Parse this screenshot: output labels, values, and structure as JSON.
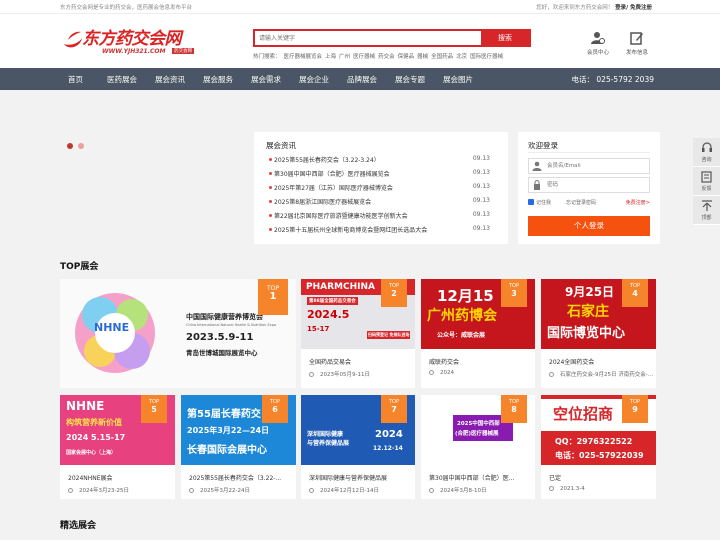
{
  "topbar": {
    "slogan": "东方药交会网是专业的药交会，医药展会信息发布平台",
    "welcome": "您好，欢迎来到东方药交会网！",
    "auth": "登录/ 免费注册"
  },
  "header": {
    "logo_name": "东方药交会网",
    "logo_url": "WWW.YJH321.COM",
    "logo_tag": "药交会网",
    "search_placeholder": "请输入关键字",
    "search_button": "搜索",
    "hot_label": "热门搜索：",
    "hot_words": [
      "医疗器械展览会",
      "上海",
      "广州",
      "医疗器械",
      "药交会",
      "保健品",
      "器械",
      "全国药品",
      "北京",
      "国际医疗器械"
    ],
    "member_center": "会员中心",
    "publish_info": "发布信息"
  },
  "nav": {
    "items": [
      "首页",
      "医药展会",
      "展会资讯",
      "展会服务",
      "展会需求",
      "展会企业",
      "品牌展会",
      "展会专题",
      "展会图片"
    ],
    "phone": "电话： 025-5792 2039"
  },
  "news": {
    "title": "展会资讯",
    "items": [
      {
        "title": "2025第55届长春药交会（3.22-3.24）",
        "date": "09.13"
      },
      {
        "title": "第30届中国中西部（合肥）医疗器械展览会",
        "date": "09.13"
      },
      {
        "title": "2025年第27届（江苏）国际医疗器械博览会",
        "date": "09.13"
      },
      {
        "title": "2025第8届浙江国际医疗器械展览会",
        "date": "09.13"
      },
      {
        "title": "第22届北京国际医疗旅游暨健康功能医学创新大会",
        "date": "09.13"
      },
      {
        "title": "2025第十五届杭州全球新电商博览会暨网红团长选品大会",
        "date": "09.13"
      }
    ]
  },
  "login": {
    "title": "欢迎登录",
    "user_placeholder": "会员名/Emali",
    "pass_placeholder": "密码",
    "remember": "记住我",
    "forgot": "忘记登录密码",
    "register": "免费注册>",
    "submit": "个人登录"
  },
  "side": {
    "consult": "咨询",
    "feedback": "反馈",
    "top": "顶部"
  },
  "sections": {
    "top": "TOP展会",
    "featured": "精选展会"
  },
  "badge_label": "TOP",
  "cards": [
    {
      "rank": "1",
      "caption": "",
      "sub": "",
      "img": {
        "t1": "NHNE",
        "t2": "中国国际健康营养博览会",
        "t3": "China International Natural Health & Nutrition Expo",
        "t4": "2023.5.9-11",
        "t5": "青岛世博城国际展览中心"
      }
    },
    {
      "rank": "2",
      "caption": "全国药品交易会",
      "sub": "2023年05月9-11日",
      "img": {
        "t1": "PHARMCHINA",
        "t2": "第88届全国药品交易会",
        "t3": "2024.5",
        "t4": "15-17",
        "t5": "扫码预登记 免排队进场"
      }
    },
    {
      "rank": "3",
      "caption": "威联药交会",
      "sub": "2024",
      "img": {
        "t1": "12月15",
        "t2": "广州药博会",
        "t3": "公众号：威联会展"
      }
    },
    {
      "rank": "4",
      "caption": "2024全国药交会",
      "sub": "石家庄药交会-9月25日 济南药交会-...",
      "img": {
        "t1": "9月25日",
        "t2": "石家庄",
        "t3": "国际博览中心"
      }
    },
    {
      "rank": "5",
      "caption": "2024NHNE展会",
      "sub": "2024年3月23-25日",
      "img": {
        "t1": "NHNE",
        "t2": "构筑营养新价值",
        "t3": "2024 5.15-17",
        "t4": "国家会展中心（上海）"
      }
    },
    {
      "rank": "6",
      "caption": "2025第55届长春药交会（3.22-...",
      "sub": "2025年3月22-24日",
      "img": {
        "t1": "第55届长春药交",
        "t2": "2025年3月22—24日",
        "t3": "长春国际会展中心"
      }
    },
    {
      "rank": "7",
      "caption": "深圳国际健康与营养保健品展",
      "sub": "2024年12月12日-14日",
      "img": {
        "t1": "深圳国际健康",
        "t2": "与营养保健品展",
        "t3": "2024",
        "t4": "12.12-14"
      }
    },
    {
      "rank": "8",
      "caption": "第30届中国中西部（合肥）医...",
      "sub": "2024年3月8-10日",
      "img": {
        "t1": "2025中国中西部",
        "t2": "(合肥)医疗器械展"
      }
    },
    {
      "rank": "9",
      "caption": "已定",
      "sub": "2021.3-4",
      "img": {
        "t1": "空位招商",
        "t2": "QQ：2976322522",
        "t3": "电话：025-57922039"
      }
    }
  ],
  "colors": {
    "accent": "#d7262a",
    "nav_bg": "#4a5565",
    "badge": "#f5842b",
    "login_button": "#f5520f"
  }
}
